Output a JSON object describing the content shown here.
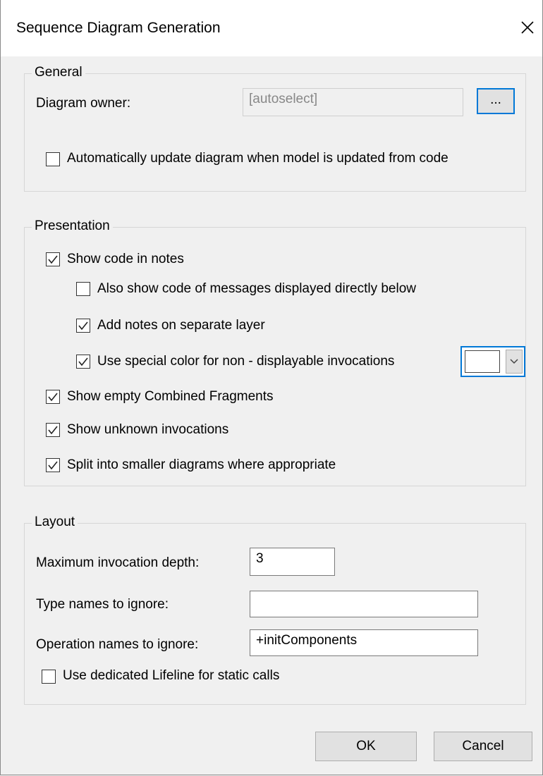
{
  "window": {
    "title": "Sequence Diagram Generation",
    "close_label": "✕"
  },
  "general": {
    "legend": "General",
    "owner_label": "Diagram owner:",
    "owner_value": "[autoselect]",
    "browse_label": "...",
    "auto_update": {
      "label": "Automatically update diagram when model is updated from code",
      "checked": false
    }
  },
  "presentation": {
    "legend": "Presentation",
    "show_code": {
      "label": "Show code in notes",
      "checked": true
    },
    "also_show": {
      "label": "Also show code of messages displayed directly below",
      "checked": false
    },
    "separate_layer": {
      "label": "Add notes on separate layer",
      "checked": true
    },
    "special_color": {
      "label": "Use special color for non - displayable invocations",
      "checked": true,
      "color": "#ffffff"
    },
    "empty_fragments": {
      "label": "Show empty Combined Fragments",
      "checked": true
    },
    "unknown_invocations": {
      "label": "Show unknown invocations",
      "checked": true
    },
    "split": {
      "label": "Split into smaller diagrams where appropriate",
      "checked": true
    }
  },
  "layout": {
    "legend": "Layout",
    "max_depth_label": "Maximum invocation depth:",
    "max_depth_value": "3",
    "type_ignore_label": "Type names to ignore:",
    "type_ignore_value": "",
    "op_ignore_label": "Operation names to ignore:",
    "op_ignore_value": "+initComponents",
    "dedicated_lifeline": {
      "label": "Use dedicated Lifeline for static calls",
      "checked": false
    }
  },
  "buttons": {
    "ok": "OK",
    "cancel": "Cancel"
  }
}
